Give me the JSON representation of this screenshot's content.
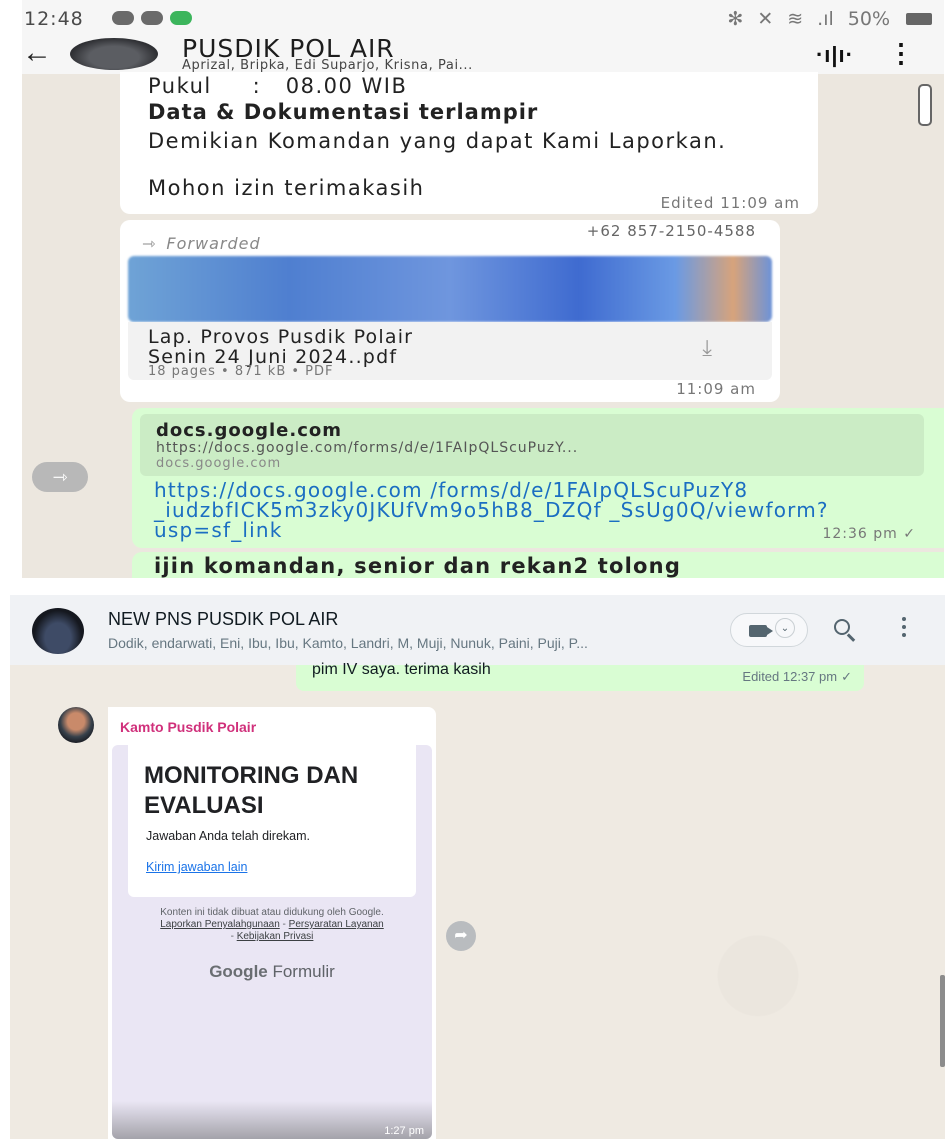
{
  "mobile": {
    "status": {
      "time": "12:48",
      "battery": "50%"
    },
    "header": {
      "back_glyph": "←",
      "title": "PUSDIK POL AIR",
      "participants": "Aprizal, Bripka, Edi Suparjo, Krisna, Pai...",
      "voice_glyph": "·ı|ı·",
      "menu_glyph": "⋮"
    },
    "messages": [
      {
        "lines": [
          "Pukul     :   08.00 WIB",
          "Data & Dokumentasi terlampir",
          "Demikian Komandan yang dapat Kami Laporkan.",
          "Mohon izin terimakasih"
        ],
        "meta": "Edited 11:09 am"
      },
      {
        "sender": "+62 857-2150-4588",
        "forwarded_label": "Forwarded",
        "doc_name_1": "Lap. Provos Pusdik Polair",
        "doc_name_2": "Senin 24 Juni 2024..pdf",
        "doc_info": "18 pages • 871 kB • PDF",
        "time": "11:09 am"
      },
      {
        "preview_title": "docs.google.com",
        "preview_url": "https://docs.google.com/forms/d/e/1FAIpQLScuPuzY...",
        "preview_domain": "docs.google.com",
        "link": "https://docs.google.com /forms/d/e/1FAIpQLScuPuzY8 _iudzbfICK5m3zky0JKUfVm9o5hB8_DZQf _SsUg0Q/viewform?usp=sf_link",
        "time": "12:36 pm ✓"
      },
      {
        "text": "ijin komandan, senior dan rekan2 tolong"
      }
    ]
  },
  "desktop": {
    "header": {
      "title": "NEW PNS PUSDIK POL AIR",
      "participants": "Dodik, endarwati, Eni, Ibu, Ibu, Kamto, Landri, M, Muji, Nunuk, Paini, Puji, P...",
      "chevron_glyph": "⌄"
    },
    "outgoing": {
      "text": "pim IV saya. terima kasih",
      "meta": "Edited 12:37 pm",
      "check": "✓"
    },
    "incoming": {
      "sender": "Kamto Pusdik Polair",
      "form_title": "MONITORING DAN EVALUASI",
      "response_text": "Jawaban Anda telah direkam.",
      "another_link": "Kirim jawaban lain",
      "disclaimer": "Konten ini tidak dibuat atau didukung oleh Google.",
      "link_abuse": "Laporkan Penyalahgunaan",
      "link_terms": "Persyaratan Layanan",
      "link_privacy": "Kebijakan Privasi",
      "sep1": " - ",
      "sep2": " - ",
      "brand_google": "Google",
      "brand_formulir": " Formulir",
      "time": "1:27 pm"
    }
  },
  "icons": {
    "forward": "arrow-forward-icon",
    "download": "download-icon"
  }
}
